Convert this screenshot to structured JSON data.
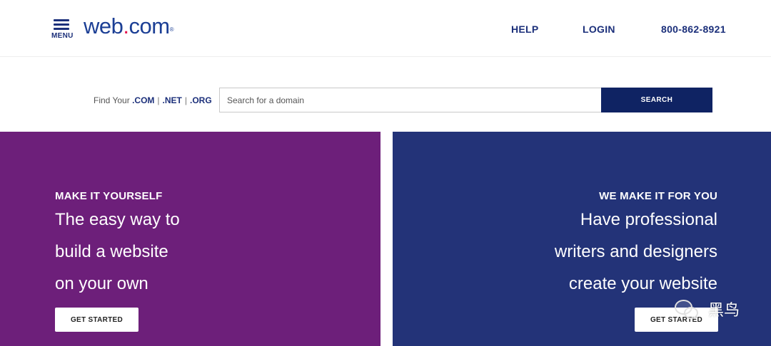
{
  "header": {
    "menu_label": "MENU",
    "logo": {
      "text_main": "web",
      "text_dot": ".",
      "text_tld": "com",
      "mark": "®"
    },
    "nav": {
      "help": "HELP",
      "login": "LOGIN",
      "phone": "800-862-8921"
    }
  },
  "search": {
    "find_prefix": "Find Your",
    "tld_com": ".COM",
    "tld_net": ".NET",
    "tld_org": ".ORG",
    "separator": "|",
    "placeholder": "Search for a domain",
    "button_label": "SEARCH"
  },
  "panels": {
    "left": {
      "title": "MAKE IT YOURSELF",
      "lines": [
        "The easy way to",
        "build a website",
        "on your own"
      ],
      "button": "GET STARTED"
    },
    "right": {
      "title": "WE MAKE IT FOR YOU",
      "lines": [
        "Have professional",
        "writers and designers",
        "create your website"
      ],
      "button": "GET STARTED"
    }
  },
  "watermark": {
    "icon": "chat-bubbles-icon",
    "text": "黑鸟"
  },
  "colors": {
    "brand_blue": "#1c3f95",
    "nav_navy": "#1b2f7a",
    "search_button": "#0f2363",
    "panel_purple": "#6d1f7a",
    "panel_navy": "#233378",
    "logo_dot": "#e4134f"
  }
}
